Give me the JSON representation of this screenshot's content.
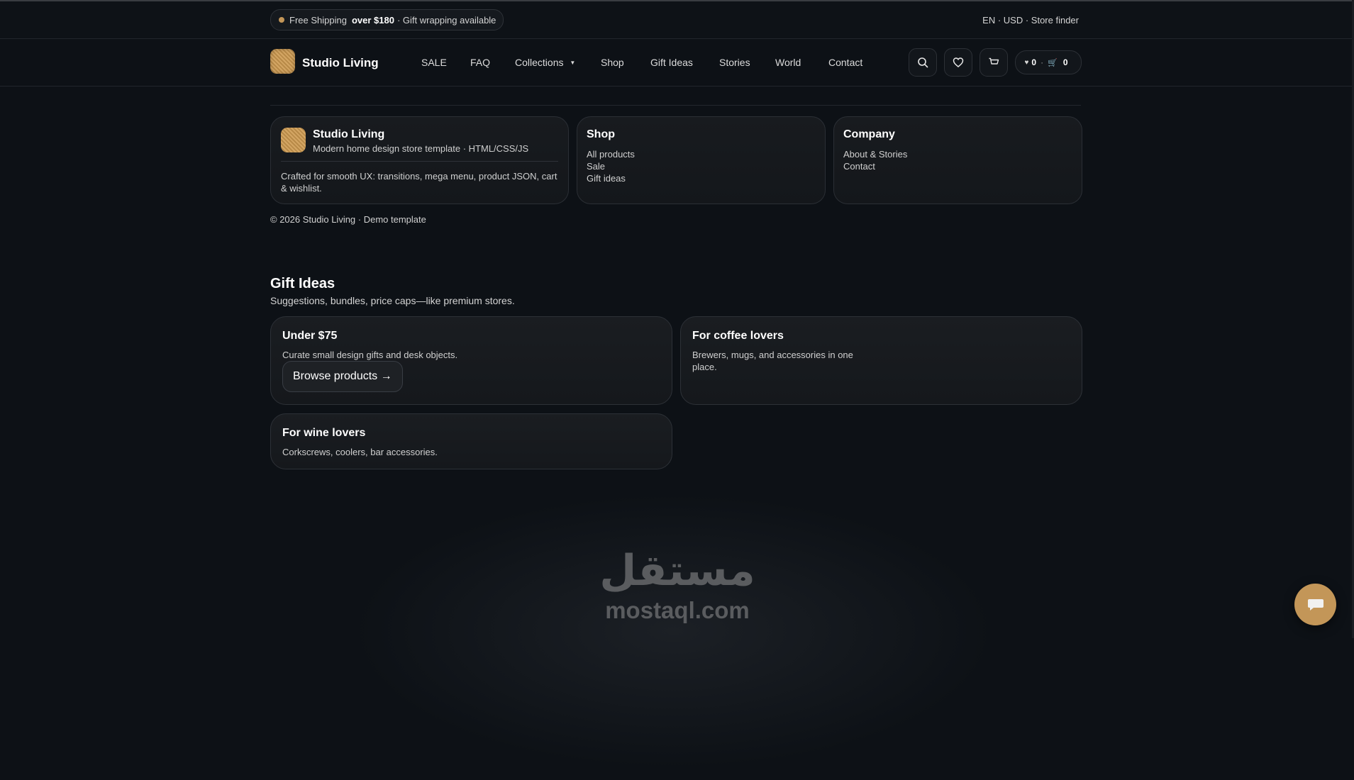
{
  "announcement": {
    "shipping_label": "Free Shipping",
    "threshold": "over $180",
    "gift_text": "· Gift wrapping available",
    "utility_links": "EN · USD · Store finder"
  },
  "header": {
    "brand": "Studio Living",
    "nav": [
      "SALE",
      "FAQ",
      "Collections",
      "Shop",
      "Gift Ideas",
      "Stories",
      "World",
      "Contact"
    ],
    "wishlist_count": "0",
    "cart_count": "0"
  },
  "footer": {
    "brand_title": "Studio Living",
    "brand_subtitle": "Modern home design store template · HTML/CSS/JS",
    "brand_desc": "Crafted for smooth UX: transitions, mega menu, product JSON, cart & wishlist.",
    "shop_title": "Shop",
    "shop_links": [
      "All products",
      "Sale",
      "Gift ideas"
    ],
    "company_title": "Company",
    "company_links": [
      "About & Stories",
      "Contact"
    ],
    "copyright": "© 2026 Studio Living · Demo template"
  },
  "gift_ideas": {
    "title": "Gift Ideas",
    "subtitle": "Suggestions, bundles, price caps—like premium stores.",
    "cards": [
      {
        "title": "Under $75",
        "desc": "Curate small design gifts and desk objects.",
        "button": "Browse products →"
      },
      {
        "title": "For coffee lovers",
        "desc": "Brewers, mugs, and accessories in one place."
      },
      {
        "title": "For wine lovers",
        "desc": "Corkscrews, coolers, bar accessories."
      }
    ]
  },
  "watermark": {
    "arabic": "مستقل",
    "latin": "mostaql.com"
  },
  "colors": {
    "accent": "#c39658",
    "background": "#0d1116",
    "card": "#171a1e"
  }
}
